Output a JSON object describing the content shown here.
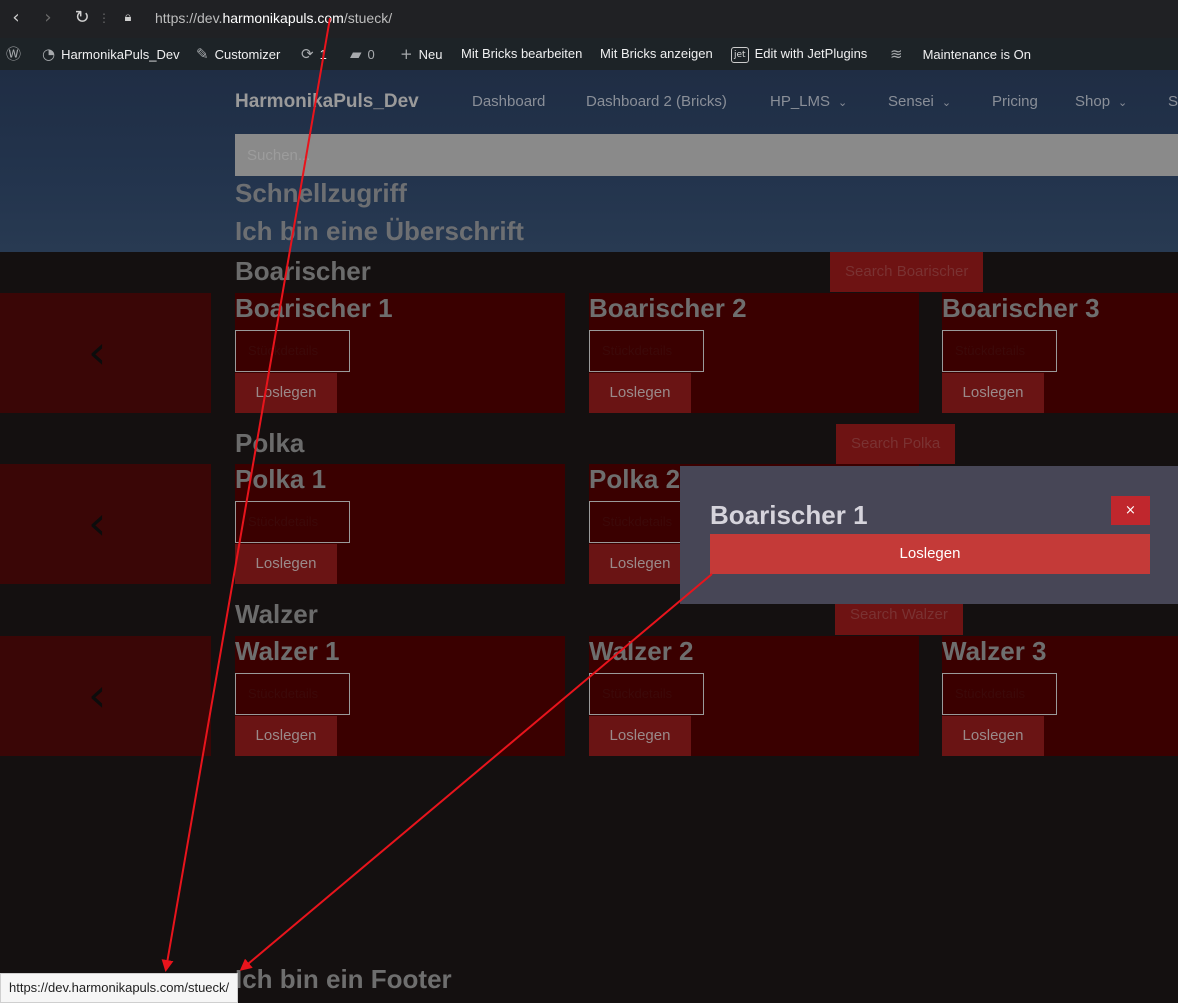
{
  "browser": {
    "url_prefix": "https://dev.",
    "url_domain": "harmonikapuls.com",
    "url_path": "/stueck/",
    "back_icon": "back-arrow-icon",
    "forward_icon": "forward-arrow-icon",
    "reload_icon": "reload-icon",
    "lock_icon": "lock-icon"
  },
  "admin_bar": {
    "site_name": "HarmonikaPuls_Dev",
    "customizer": "Customizer",
    "updates_count": "1",
    "comments_count": "0",
    "new_label": "Neu",
    "bricks_edit": "Mit Bricks bearbeiten",
    "bricks_view": "Mit Bricks anzeigen",
    "jet_label": "Edit with JetPlugins",
    "maintenance": "Maintenance is On"
  },
  "header": {
    "site_title": "HarmonikaPuls_Dev",
    "nav": [
      "Dashboard",
      "Dashboard 2 (Bricks)",
      "HP_LMS",
      "Sensei",
      "Pricing",
      "Shop",
      "S"
    ],
    "search_placeholder": "Suchen...",
    "quick_access": "Schnellzugriff",
    "placeholder_heading": "Ich bin eine Überschrift"
  },
  "sections": [
    {
      "title": "Boarischer",
      "search_label": "Search Boarischer",
      "cards": [
        {
          "title": "Boarischer 1",
          "box": "Stückdetails",
          "button": "Loslegen"
        },
        {
          "title": "Boarischer 2",
          "box": "Stückdetails",
          "button": "Loslegen"
        },
        {
          "title": "Boarischer 3",
          "box": "Stückdetails",
          "button": "Loslegen"
        }
      ]
    },
    {
      "title": "Polka",
      "search_label": "Search Polka",
      "cards": [
        {
          "title": "Polka 1",
          "box": "Stückdetails",
          "button": "Loslegen"
        },
        {
          "title": "Polka 2",
          "box": "Stückdetails",
          "button": "Loslegen"
        }
      ]
    },
    {
      "title": "Walzer",
      "search_label": "Search Walzer",
      "cards": [
        {
          "title": "Walzer 1",
          "box": "Stückdetails",
          "button": "Loslegen"
        },
        {
          "title": "Walzer 2",
          "box": "Stückdetails",
          "button": "Loslegen"
        },
        {
          "title": "Walzer 3",
          "box": "Stückdetails",
          "button": "Loslegen"
        }
      ]
    }
  ],
  "popup": {
    "title": "Boarischer 1",
    "close_label": "×",
    "cta_label": "Loslegen"
  },
  "footer": {
    "heading": "Ich bin ein Footer"
  },
  "status_bar": {
    "url": "https://dev.harmonikapuls.com/stueck/"
  },
  "colors": {
    "annotation_arrow": "#e8141c",
    "popup_button": "#c43a38",
    "card_background": "#3a0000"
  }
}
